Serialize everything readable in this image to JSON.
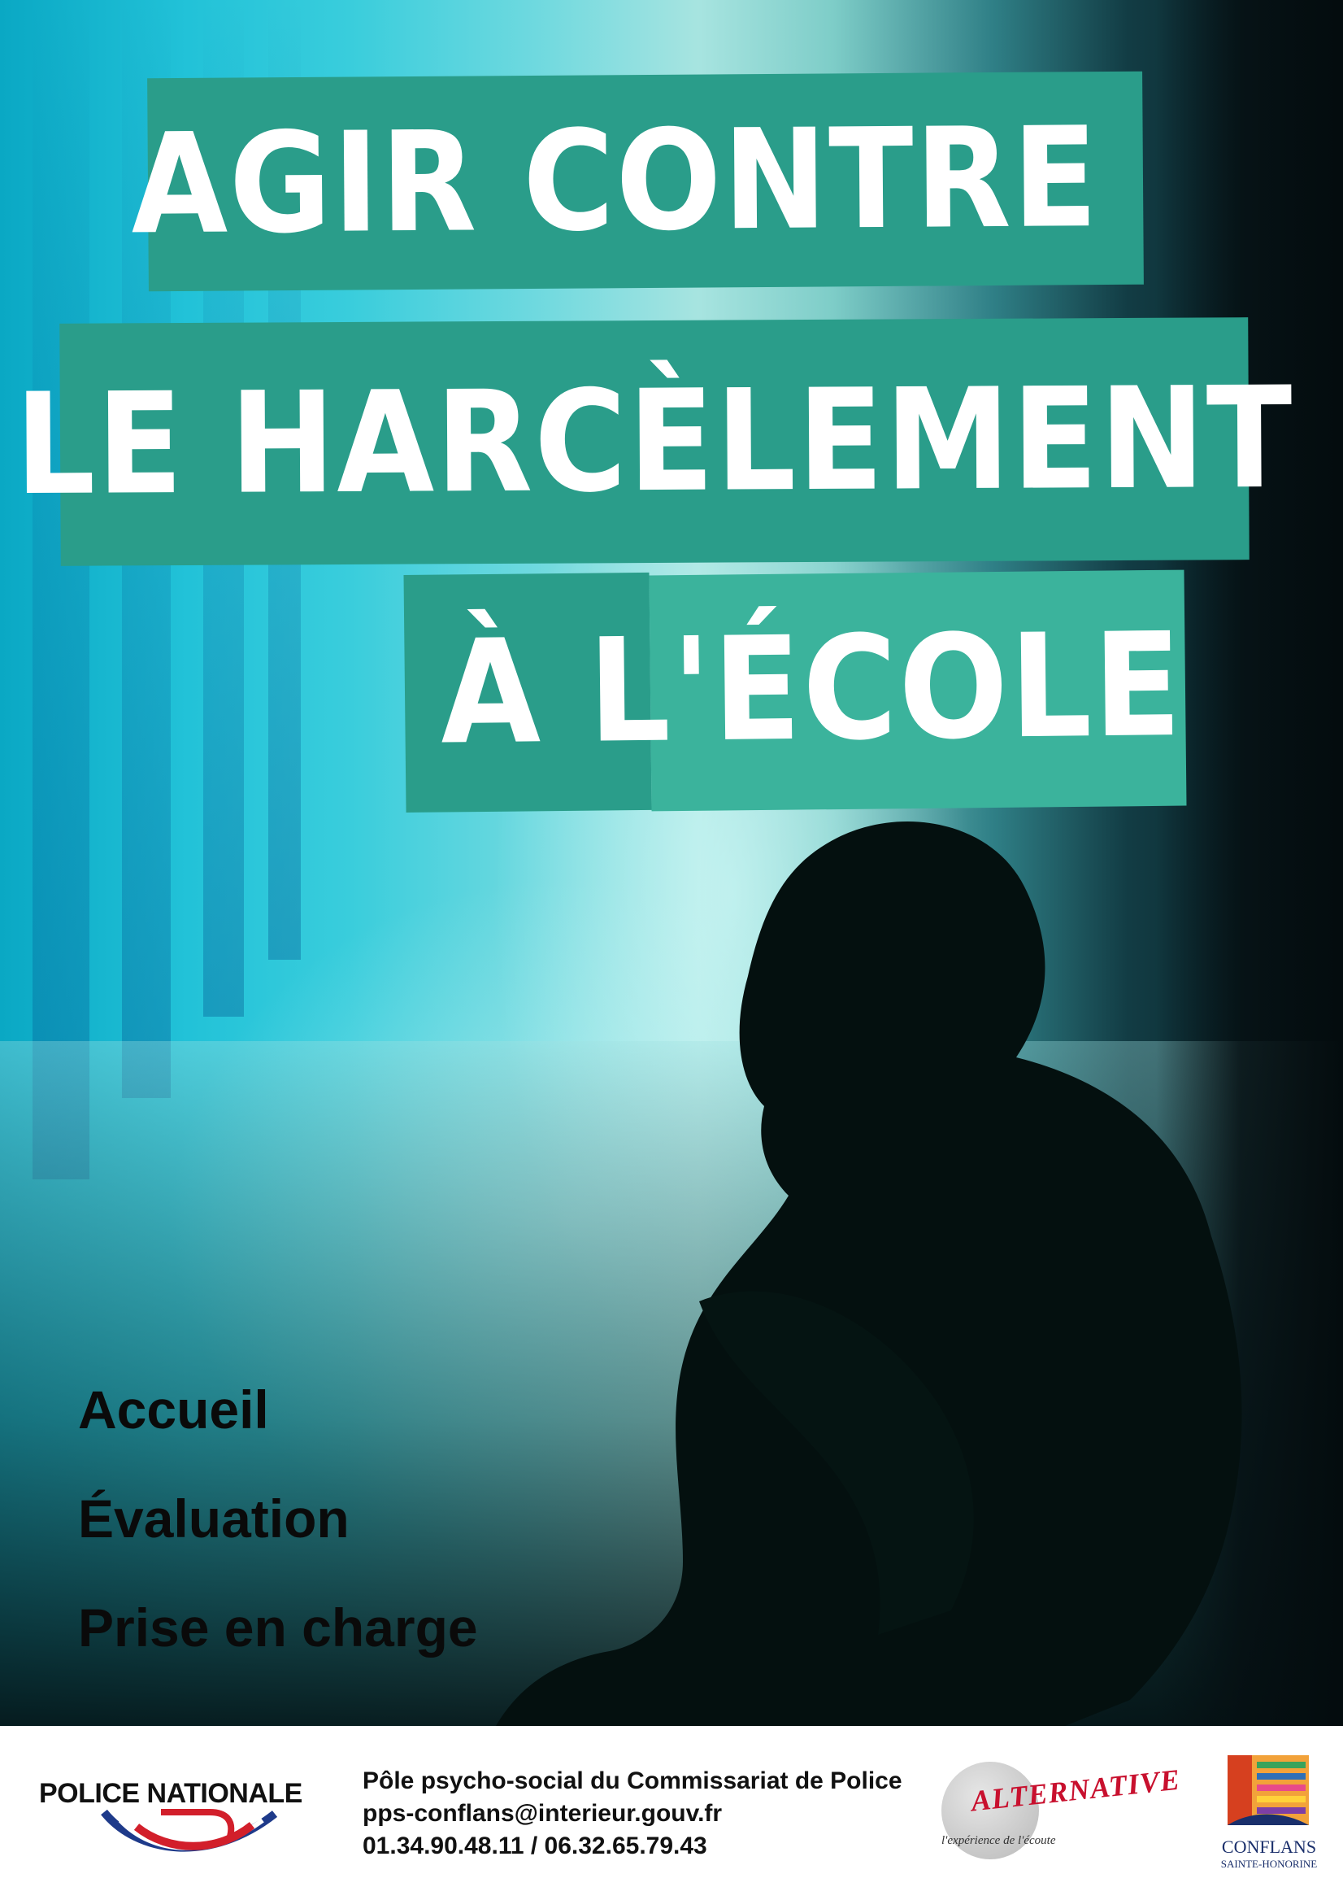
{
  "headline": {
    "line1": "AGIR CONTRE",
    "line2": "LE HARCÈLEMENT",
    "line3": "À L'ÉCOLE"
  },
  "services": [
    "Accueil",
    "Évaluation",
    "Prise en charge"
  ],
  "footer": {
    "police_logo_text": "POLICE NATIONALE",
    "contact": {
      "organization": "Pôle psycho-social du Commissariat de Police",
      "email": "pps-conflans@interieur.gouv.fr",
      "phones": "01.34.90.48.11 / 06.32.65.79.43"
    },
    "alternative_logo": {
      "name": "ALTERNATIVE",
      "tagline": "l'expérience de l'écoute"
    },
    "conflans_logo": {
      "name": "CONFLANS",
      "subtitle": "SAINTE-HONORINE"
    }
  },
  "colors": {
    "band": "#2a9d8a",
    "band_highlight": "#3bb39c",
    "text_dark": "#0a0a0a",
    "alternative_red": "#c8102e",
    "conflans_blue": "#1a2f6b"
  }
}
